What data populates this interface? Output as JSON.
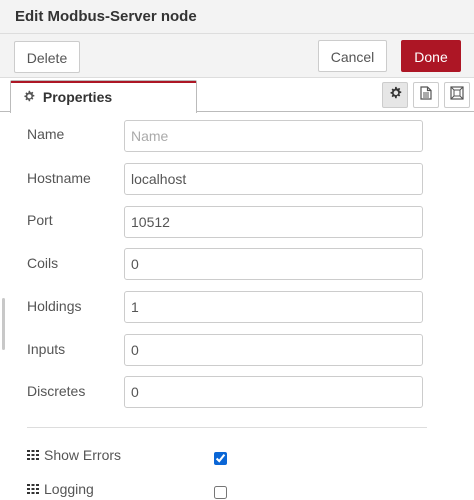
{
  "dialog": {
    "title": "Edit Modbus-Server node"
  },
  "toolbar": {
    "delete_label": "Delete",
    "cancel_label": "Cancel",
    "done_label": "Done",
    "done_color": "#ad1625"
  },
  "tabs": {
    "properties_label": "Properties",
    "properties_icon": "gear-icon",
    "icon_buttons": [
      "gear-icon",
      "description-icon",
      "appearance-icon"
    ]
  },
  "form": {
    "name": {
      "label": "Name",
      "value": "",
      "placeholder": "Name"
    },
    "hostname": {
      "label": "Hostname",
      "value": "localhost"
    },
    "port": {
      "label": "Port",
      "value": "10512"
    },
    "coils": {
      "label": "Coils",
      "value": "0"
    },
    "holdings": {
      "label": "Holdings",
      "value": "1"
    },
    "inputs": {
      "label": "Inputs",
      "value": "0"
    },
    "discretes": {
      "label": "Discretes",
      "value": "0"
    }
  },
  "options": {
    "show_errors": {
      "label": "Show Errors",
      "checked": true,
      "icon": "grid-icon"
    },
    "logging": {
      "label": "Logging",
      "checked": false,
      "icon": "grid-icon"
    }
  }
}
